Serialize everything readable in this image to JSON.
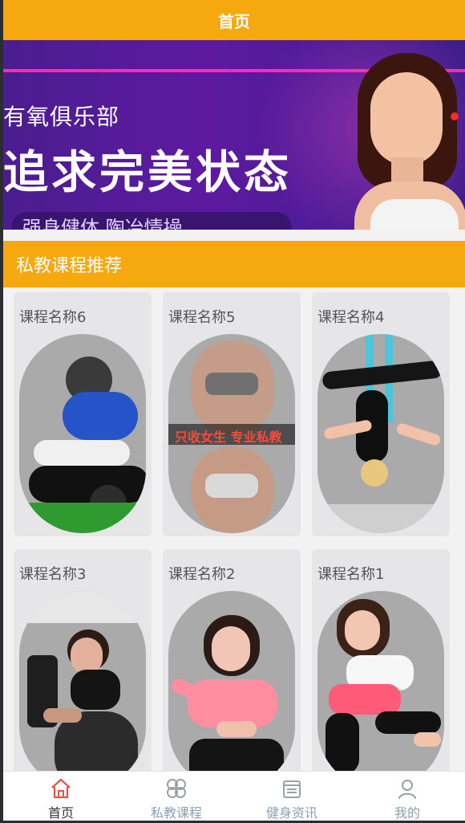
{
  "header": {
    "title": "首页"
  },
  "banner": {
    "line1": "有氧俱乐部",
    "line2": "追求完美状态",
    "line3": "强身健体 陶冶情操"
  },
  "section": {
    "title": "私教课程推荐"
  },
  "courses": [
    {
      "name": "课程名称6",
      "theme": "trainer-stretch"
    },
    {
      "name": "课程名称5",
      "theme": "female-only-training",
      "image_text": "只收女生 专业私教"
    },
    {
      "name": "课程名称4",
      "theme": "aerial-yoga"
    },
    {
      "name": "课程名称3",
      "theme": "gym-workout"
    },
    {
      "name": "课程名称2",
      "theme": "pink-workout"
    },
    {
      "name": "课程名称1",
      "theme": "floor-stretch"
    }
  ],
  "tabbar": {
    "items": [
      {
        "label": "首页",
        "icon": "home-icon",
        "active": true
      },
      {
        "label": "私教课程",
        "icon": "grid-icon",
        "active": false
      },
      {
        "label": "健身资讯",
        "icon": "news-icon",
        "active": false
      },
      {
        "label": "我的",
        "icon": "user-icon",
        "active": false
      }
    ]
  },
  "colors": {
    "accent": "#f5a90f",
    "tab_active_icon": "#e0524a",
    "tab_inactive": "#8aa1b3"
  }
}
